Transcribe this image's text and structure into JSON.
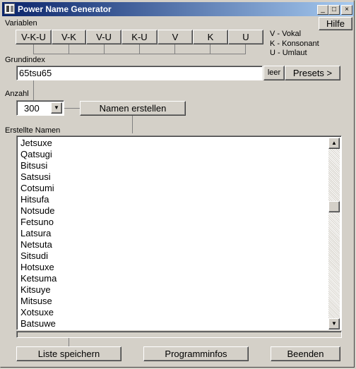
{
  "window": {
    "title": "Power Name Generator"
  },
  "header": {
    "variables_label": "Variablen",
    "help_button": "Hilfe"
  },
  "variable_buttons": [
    "V-K-U",
    "V-K",
    "V-U",
    "K-U",
    "V",
    "K",
    "U"
  ],
  "legend": [
    "V - Vokal",
    "K - Konsonant",
    "U - Umlaut"
  ],
  "grundindex": {
    "label": "Grundindex",
    "value": "65tsu65",
    "clear_button": "leer",
    "presets_button": "Presets >"
  },
  "anzahl": {
    "label": "Anzahl",
    "value": "300",
    "generate_button": "Namen erstellen"
  },
  "names": {
    "label": "Erstellte Namen",
    "items": [
      "Jetsuxe",
      "Qatsugi",
      "Bitsusi",
      "Satsusi",
      "Cotsumi",
      "Hitsufa",
      "Notsude",
      "Fetsuno",
      "Latsura",
      "Netsuta",
      "Sitsudi",
      "Hotsuxe",
      "Ketsuma",
      "Kitsuye",
      "Mitsuse",
      "Xotsuxe",
      "Batsuwe"
    ],
    "scroll_position": 0.33
  },
  "footer": {
    "save_button": "Liste speichern",
    "info_button": "Programminfos",
    "exit_button": "Beenden"
  },
  "title_buttons": {
    "minimize": "_",
    "maximize": "□",
    "close": "×"
  }
}
